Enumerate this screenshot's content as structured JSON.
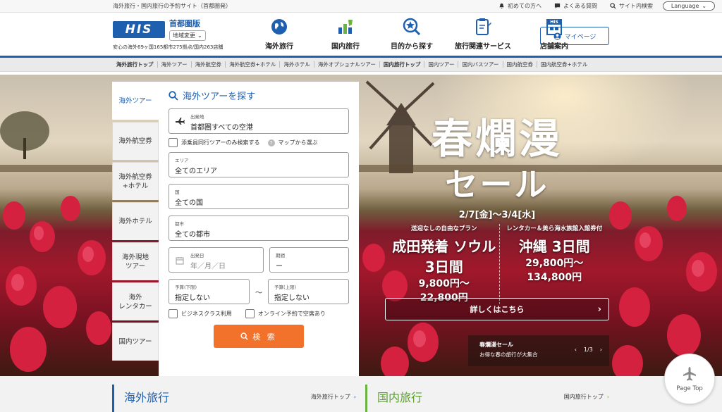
{
  "topbar": {
    "tagline": "海外旅行・国内旅行の予約サイト（首都圏発）",
    "links": [
      "初めての方へ",
      "よくある質問",
      "サイト内検索"
    ],
    "language": "Language"
  },
  "header": {
    "logo": "HIS",
    "region": "首都圏版",
    "region_change": "地域変更",
    "sub": "安心の海外69ヶ国165都市275拠点/国内263店舗",
    "nav": [
      "海外旅行",
      "国内旅行",
      "目的から探す",
      "旅行関連サービス",
      "店舗案内"
    ],
    "mypage": "マイページ"
  },
  "subnav": [
    "海外旅行トップ",
    "海外ツアー",
    "海外航空券",
    "海外航空券+ホテル",
    "海外ホテル",
    "海外オプショナルツアー",
    "国内旅行トップ",
    "国内ツアー",
    "国内バスツアー",
    "国内航空券",
    "国内航空券+ホテル"
  ],
  "tabs": [
    {
      "l1": "海外ツアー",
      "l2": ""
    },
    {
      "l1": "海外航空券",
      "l2": ""
    },
    {
      "l1": "海外航空券",
      "l2": "+ホテル"
    },
    {
      "l1": "海外ホテル",
      "l2": ""
    },
    {
      "l1": "海外現地",
      "l2": "ツアー"
    },
    {
      "l1": "海外",
      "l2": "レンタカー"
    },
    {
      "l1": "国内ツアー",
      "l2": ""
    }
  ],
  "search": {
    "title": "海外ツアーを探す",
    "departure_label": "出発地",
    "departure_value": "首都圏すべての空港",
    "escort_only": "添乗員同行ツアーのみ検索する",
    "map_select": "マップから選ぶ",
    "area_label": "エリア",
    "area_value": "全てのエリア",
    "country_label": "国",
    "country_value": "全ての国",
    "city_label": "都市",
    "city_value": "全ての都市",
    "date_label": "出発日",
    "date_value": "年／月／日",
    "period_label": "期間",
    "period_value": "ー",
    "budget_min_label": "予算(下限)",
    "budget_min_value": "指定しない",
    "budget_tilde": "～",
    "budget_max_label": "予算(上限)",
    "budget_max_value": "指定しない",
    "business_class": "ビジネスクラス利用",
    "online_available": "オンライン予約で空席あり",
    "button": "検 索"
  },
  "promo": {
    "line1": "春爛漫",
    "line2": "セール",
    "dates": "2/7[金]～3/4[水]",
    "deal1_note": "送迎なしの自由なプラン",
    "deal1_dest": "成田発着 ソウル3日間",
    "deal1_price1": "9,800円～",
    "deal1_price2": "22,800円",
    "deal2_note": "レンタカー＆美ら海水族館入館券付",
    "deal2_dest": "沖縄 3日間",
    "deal2_price1": "29,800円～",
    "deal2_price2": "134,800円",
    "detail": "詳しくはこちら",
    "carousel_title": "春爛漫セール",
    "carousel_sub": "お得な春の旅行が大集合",
    "pager": "1/3"
  },
  "pagetop": "Page Top",
  "bottom": {
    "overseas_title": "海外旅行",
    "overseas_link": "海外旅行トップ",
    "domestic_title": "国内旅行",
    "domestic_link": "国内旅行トップ"
  },
  "colors": {
    "brand": "#1f5fb0",
    "search_button": "#f2722c",
    "domestic_accent": "#6cb33f"
  }
}
